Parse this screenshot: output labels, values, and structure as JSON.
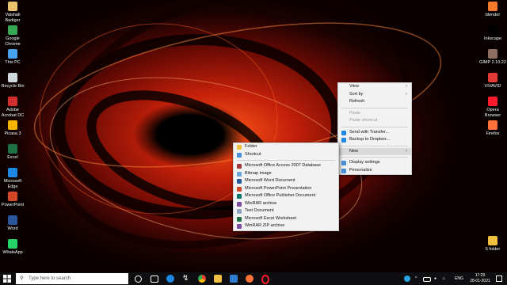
{
  "desktop": {
    "left_icons": [
      {
        "label": "Vaishali Badiger",
        "color": "#e9c46a"
      },
      {
        "label": "Google Chrome",
        "color": "#34a853"
      },
      {
        "label": "This PC",
        "color": "#4aa3f0"
      },
      {
        "label": "Recycle Bin",
        "color": "#cfd8dc"
      },
      {
        "label": "Adobe Acrobat DC",
        "color": "#d32f2f"
      },
      {
        "label": "Picasa 3",
        "color": "#f4b400"
      },
      {
        "label": "Excel",
        "color": "#1e7145"
      },
      {
        "label": "Microsoft Edge",
        "color": "#1e88e5"
      },
      {
        "label": "PowerPoint",
        "color": "#d24726"
      },
      {
        "label": "Word",
        "color": "#2b579a"
      },
      {
        "label": "WhatsApp",
        "color": "#25d366"
      }
    ],
    "right_icons": [
      {
        "label": "blender",
        "color": "#f5792a"
      },
      {
        "label": "Inkscape",
        "color": "#000000"
      },
      {
        "label": "GIMP 2.10.22",
        "color": "#8d6e63"
      },
      {
        "label": "VIVAVID",
        "color": "#e53935"
      },
      {
        "label": "Opera Browser",
        "color": "#ff1b2d"
      },
      {
        "label": "Firefox",
        "color": "#ff7139"
      },
      {
        "label": "5 folder",
        "color": "#f0c040"
      }
    ]
  },
  "context_menu": {
    "items": [
      {
        "label": "View",
        "submenu": true
      },
      {
        "label": "Sort by",
        "submenu": true
      },
      {
        "label": "Refresh"
      },
      {
        "sep": true
      },
      {
        "label": "Paste",
        "disabled": true
      },
      {
        "label": "Paste shortcut",
        "disabled": true
      },
      {
        "sep": true
      },
      {
        "label": "Send with Transfer...",
        "icon_color": "#1e88e5"
      },
      {
        "label": "Backup to Dropbox...",
        "icon_color": "#1e88e5"
      },
      {
        "sep": true
      },
      {
        "label": "New",
        "submenu": true,
        "highlighted": true
      },
      {
        "sep": true
      },
      {
        "label": "Display settings",
        "icon_color": "#4a90d9"
      },
      {
        "label": "Personalize",
        "icon_color": "#4a90d9"
      }
    ]
  },
  "new_submenu": {
    "items": [
      {
        "label": "Folder",
        "icon_color": "#f0c040"
      },
      {
        "label": "Shortcut",
        "icon_color": "#4a90d9"
      },
      {
        "sep": true
      },
      {
        "label": "Microsoft Office Access 2007 Database",
        "icon_color": "#a4373a"
      },
      {
        "label": "Bitmap image",
        "icon_color": "#6aa6d8"
      },
      {
        "label": "Microsoft Word Document",
        "icon_color": "#2b579a"
      },
      {
        "label": "Microsoft PowerPoint Presentation",
        "icon_color": "#d24726"
      },
      {
        "label": "Microsoft Office Publisher Document",
        "icon_color": "#077568"
      },
      {
        "label": "WinRAR archive",
        "icon_color": "#7b4b9e"
      },
      {
        "label": "Text Document",
        "icon_color": "#8fa7c0"
      },
      {
        "label": "Microsoft Excel Worksheet",
        "icon_color": "#1e7145"
      },
      {
        "label": "WinRAR ZIP archive",
        "icon_color": "#7b4b9e"
      }
    ]
  },
  "taskbar": {
    "search_placeholder": "Type here to search",
    "language": "ENG",
    "time": "17:29",
    "date": "28-01-2021"
  }
}
